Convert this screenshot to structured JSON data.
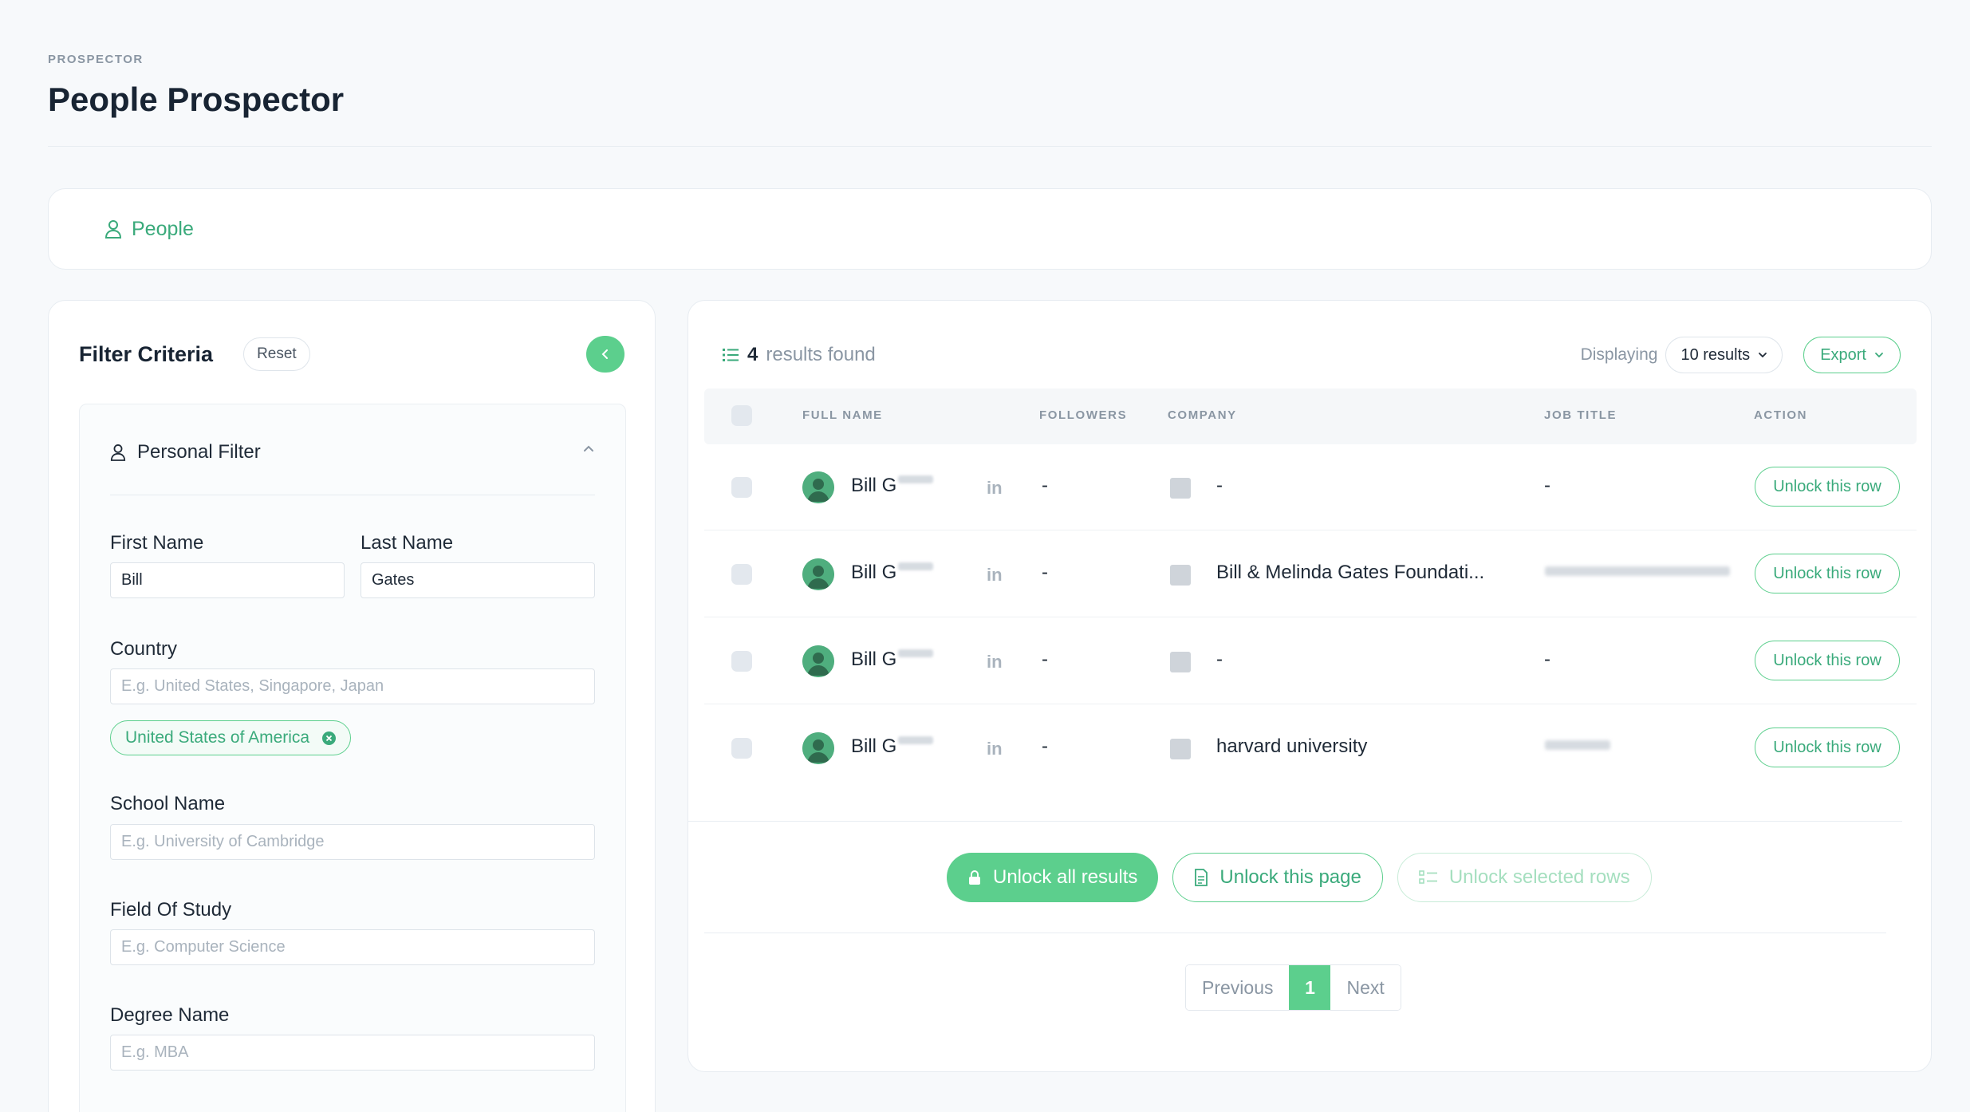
{
  "header": {
    "eyebrow": "PROSPECTOR",
    "title": "People Prospector"
  },
  "tabs": [
    {
      "label": "People",
      "icon": "user-icon"
    }
  ],
  "filter": {
    "title": "Filter Criteria",
    "reset_label": "Reset",
    "section_title": "Personal Filter",
    "first_name": {
      "label": "First Name",
      "value": "Bill"
    },
    "last_name": {
      "label": "Last Name",
      "value": "Gates"
    },
    "country": {
      "label": "Country",
      "placeholder": "E.g. United States, Singapore, Japan",
      "chip": "United States of America"
    },
    "school": {
      "label": "School Name",
      "placeholder": "E.g. University of Cambridge"
    },
    "field_of_study": {
      "label": "Field Of Study",
      "placeholder": "E.g. Computer Science"
    },
    "degree": {
      "label": "Degree Name",
      "placeholder": "E.g. MBA"
    }
  },
  "results": {
    "count": "4",
    "count_suffix": "results found",
    "displaying_label": "Displaying",
    "displaying_value": "10 results",
    "export_label": "Export",
    "columns": [
      "FULL NAME",
      "FOLLOWERS",
      "COMPANY",
      "JOB TITLE",
      "ACTION"
    ],
    "rows": [
      {
        "name": "Bill G",
        "linkedin": "in",
        "followers": "-",
        "company": "-",
        "job_title": "-",
        "action": "Unlock this row"
      },
      {
        "name": "Bill G",
        "linkedin": "in",
        "followers": "-",
        "company": "Bill & Melinda Gates Foundati...",
        "job_title": "",
        "action": "Unlock this row"
      },
      {
        "name": "Bill G",
        "linkedin": "in",
        "followers": "-",
        "company": "-",
        "job_title": "-",
        "action": "Unlock this row"
      },
      {
        "name": "Bill G",
        "linkedin": "in",
        "followers": "-",
        "company": "harvard university",
        "job_title": "",
        "action": "Unlock this row"
      }
    ],
    "unlock_all": "Unlock all results",
    "unlock_page": "Unlock this page",
    "unlock_selected": "Unlock selected rows",
    "pager": {
      "previous": "Previous",
      "current": "1",
      "next": "Next"
    }
  },
  "colors": {
    "accent": "#5ccf8d",
    "accent_text": "#3aaa7b",
    "background": "#f7f9fb"
  }
}
